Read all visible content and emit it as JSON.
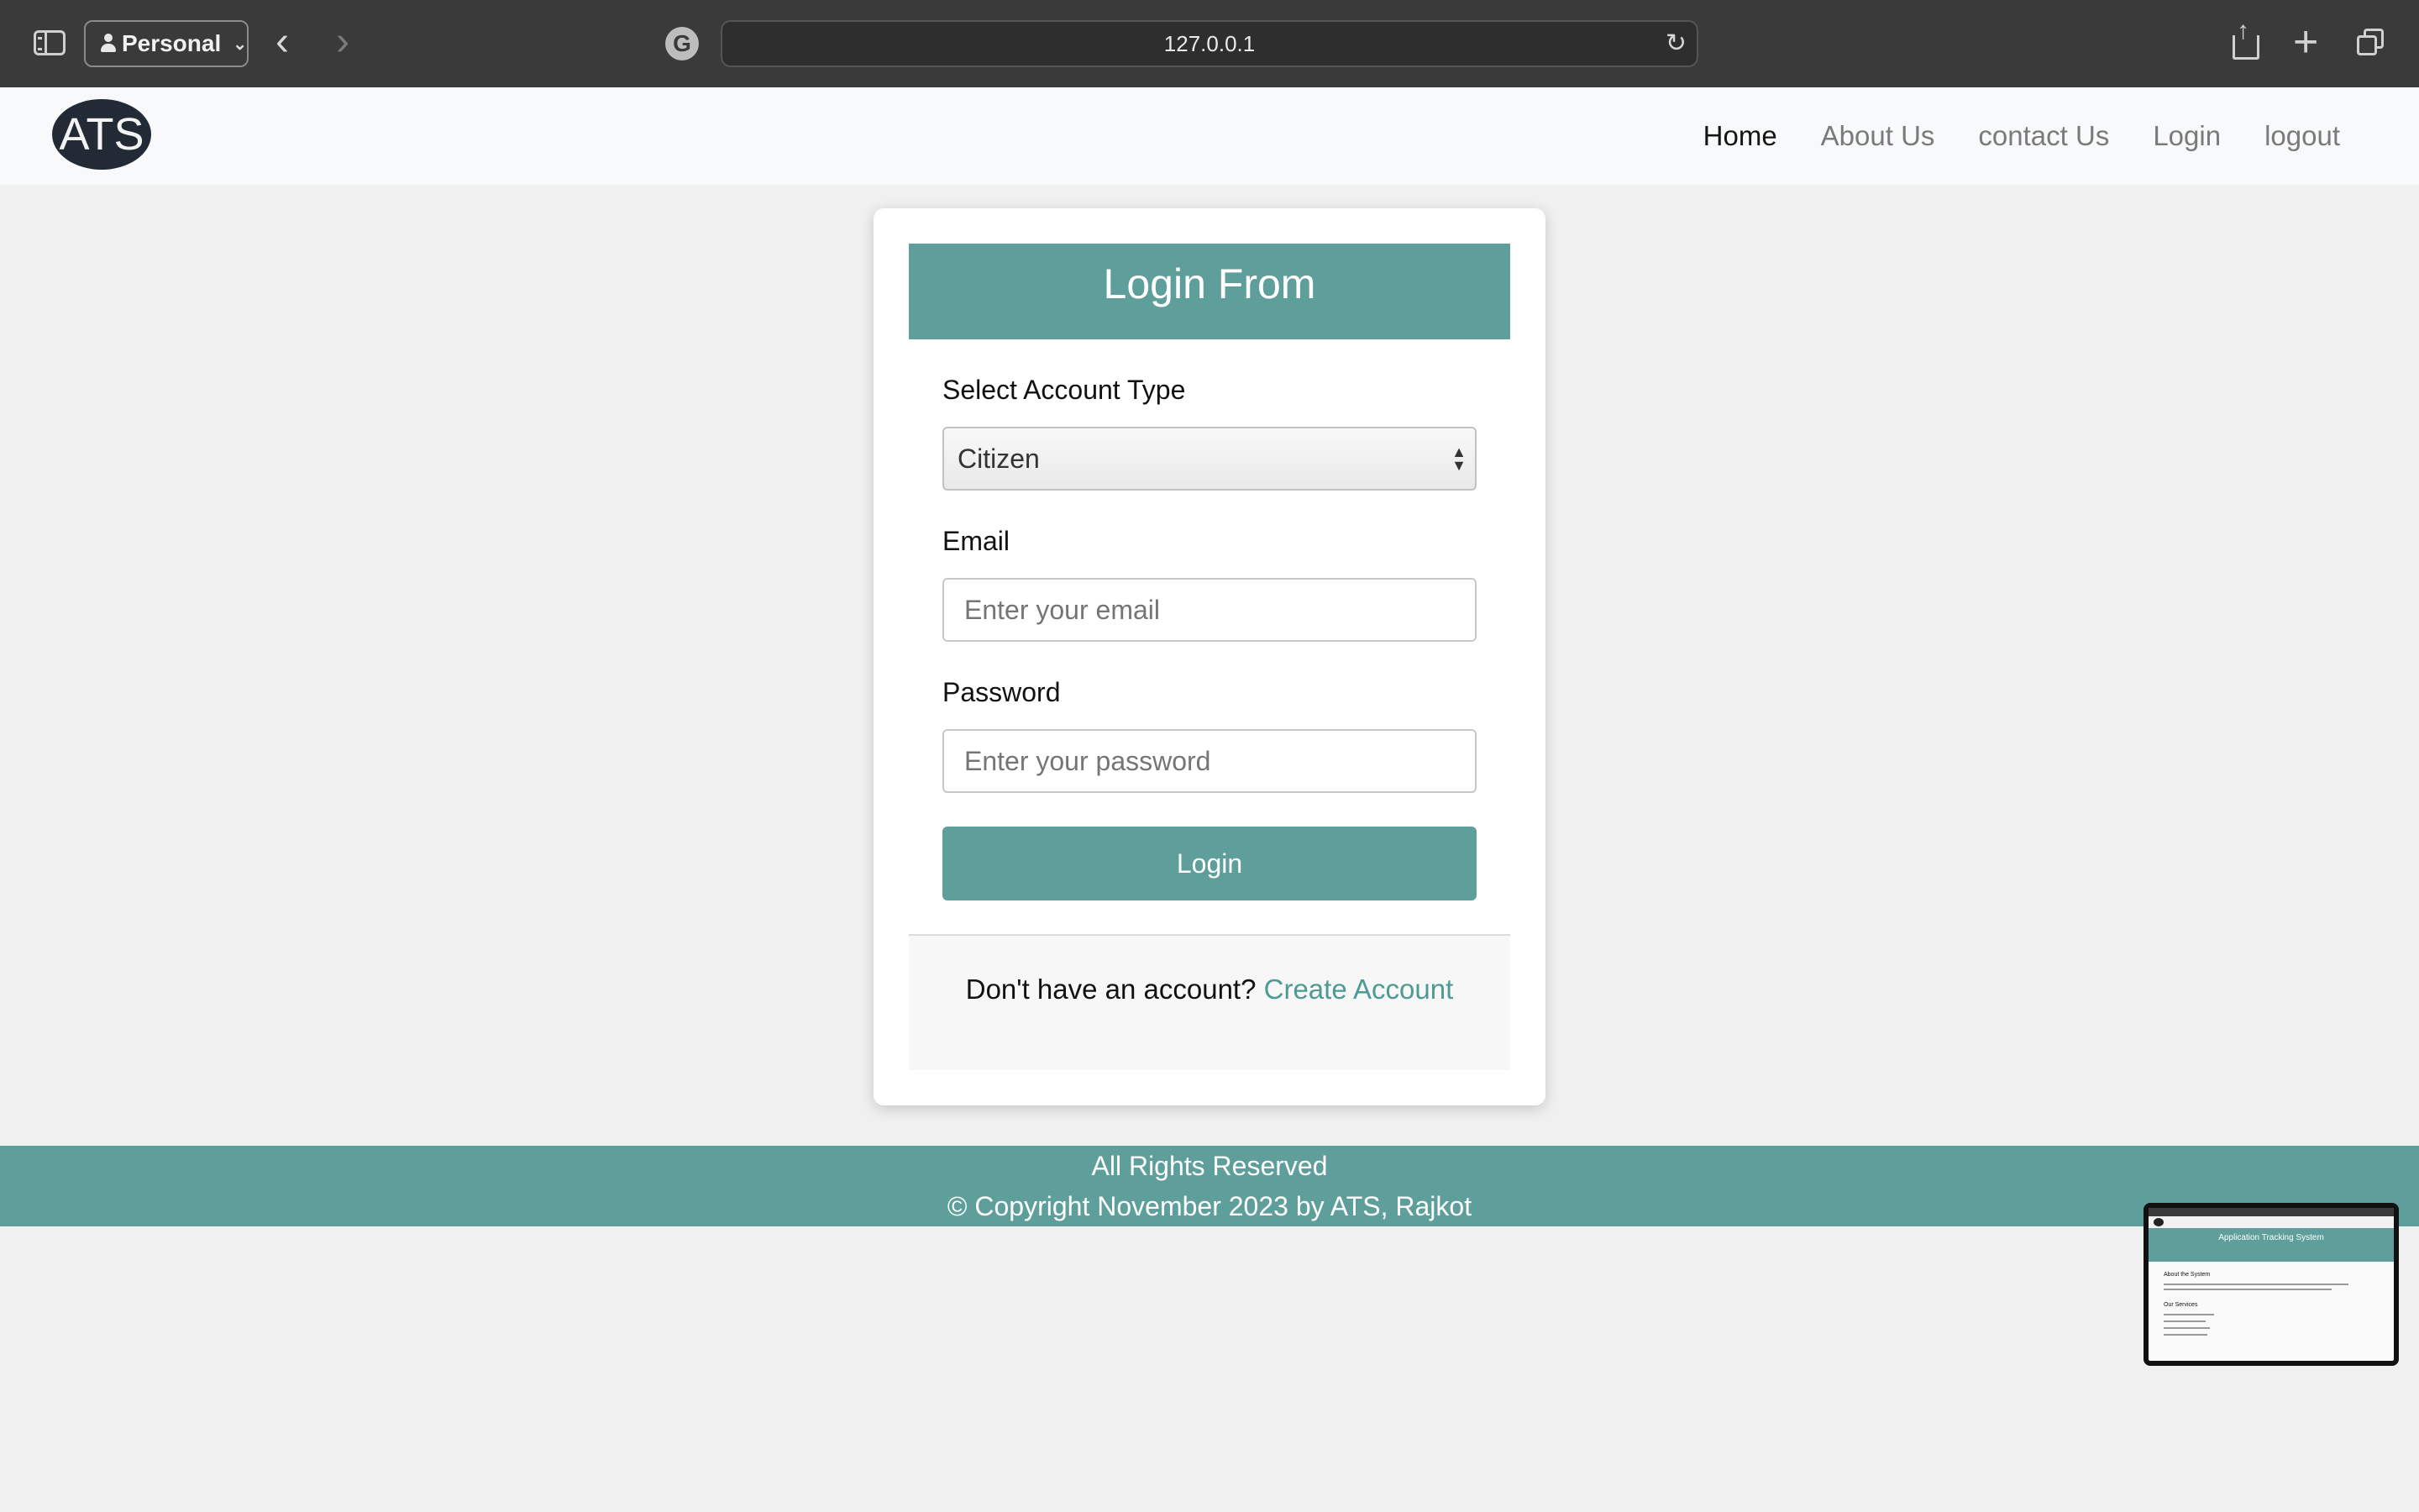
{
  "browser": {
    "profile_label": "Personal",
    "url": "127.0.0.1"
  },
  "navbar": {
    "logo": "ATS",
    "links": [
      "Home",
      "About Us",
      "contact Us",
      "Login",
      "logout"
    ]
  },
  "login_form": {
    "title": "Login From",
    "account_type_label": "Select Account Type",
    "account_type_value": "Citizen",
    "email_label": "Email",
    "email_placeholder": "Enter your email",
    "password_label": "Password",
    "password_placeholder": "Enter your password",
    "submit_label": "Login",
    "footer_text": "Don't have an account?",
    "create_account_link": "Create Account"
  },
  "footer": {
    "line1": "All Rights Reserved",
    "line2": "© Copyright November 2023 by ATS, Rajkot"
  },
  "thumbnail": {
    "hero_title": "Application Tracking System",
    "about_heading": "About the System",
    "services_heading": "Our Services"
  },
  "colors": {
    "accent": "#5f9f9b",
    "link": "#4e9a94",
    "chrome": "#3a3a3a",
    "page_bg": "#f0f0f0"
  }
}
